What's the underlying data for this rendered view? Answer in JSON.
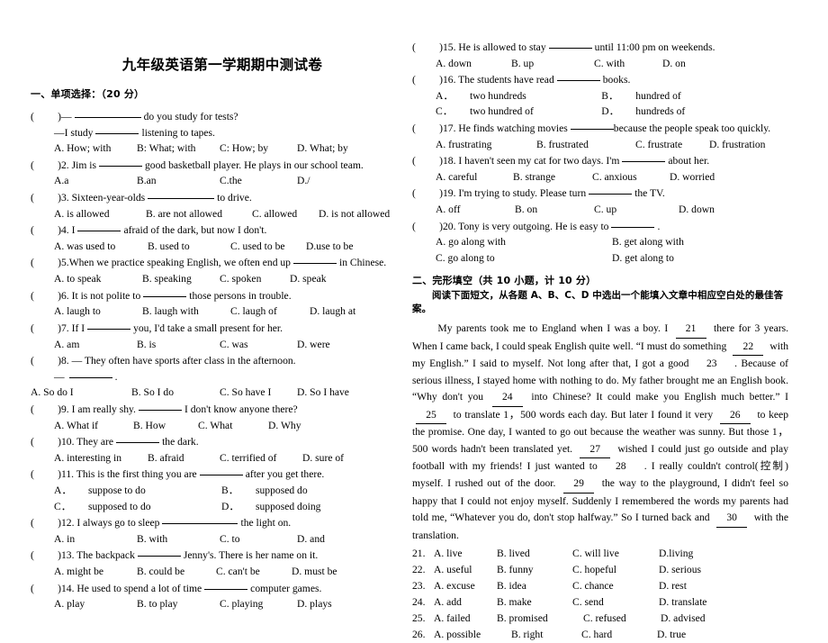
{
  "document": {
    "title": "九年级英语第一学期期中测试卷"
  },
  "sections": {
    "part1": {
      "heading": "一、单项选择：（20 分）"
    },
    "part2": {
      "heading": "二、完形填空（共 10 小题，计 10 分）",
      "instruction": "阅读下面短文，从各题 A、B、C、D 中选出一个能填入文章中相应空白处的最佳答案。"
    }
  },
  "left_column": {
    "questions": [
      {
        "num": "1",
        "stem_a": "—",
        "stem_b": "do you study for tests?",
        "stem2_a": "—I study",
        "stem2_b": "listening to tapes.",
        "options": [
          "A. How; with",
          "B: What; with",
          "C: How; by",
          "D. What; by"
        ]
      },
      {
        "num": "2",
        "stem_a": "2. Jim is",
        "stem_b": "good basketball player. He plays in our school team.",
        "options": [
          "A.a",
          "B.an",
          "C.the",
          "D./"
        ]
      },
      {
        "num": "3",
        "stem_a": "3. Sixteen-year-olds",
        "stem_b": "to drive.",
        "options": [
          "A. is allowed",
          "B. are not allowed",
          "C. allowed",
          "D. is not allowed"
        ]
      },
      {
        "num": "4",
        "stem_a": "4. I",
        "stem_b": "afraid of the dark, but now I don't.",
        "options": [
          "A. was used to",
          "B. used to",
          "C. used to be",
          "D.use to be"
        ]
      },
      {
        "num": "5",
        "stem_a": "5.When we practice speaking English, we often end up",
        "stem_b": "in Chinese.",
        "options": [
          "A. to speak",
          "B. speaking",
          "C. spoken",
          "D. speak"
        ]
      },
      {
        "num": "6",
        "stem_a": "6. It is not polite to",
        "stem_b": "those persons in trouble.",
        "options": [
          "A. laugh to",
          "B. laugh with",
          "C. laugh of",
          "D. laugh at"
        ]
      },
      {
        "num": "7",
        "stem_a": "7. If I",
        "stem_b": "you, I'd take a small present for her.",
        "options": [
          "A. am",
          "B. is",
          "C. was",
          "D. were"
        ]
      },
      {
        "num": "8",
        "stem_a": "8. — They often have sports after class in the afternoon.",
        "stem_b": "",
        "answer_line": "—",
        "options": [
          "A. So do I",
          "B. So I do",
          "C. So have I",
          "D. So I have"
        ]
      },
      {
        "num": "9",
        "stem_a": "9. I am really shy.",
        "stem_b": "I don't know anyone there?",
        "options": [
          "A. What if",
          "B. How",
          "C. What",
          "D. Why"
        ]
      },
      {
        "num": "10",
        "stem_a": "10. They are",
        "stem_b": "the dark.",
        "options": [
          "A. interesting in",
          "B. afraid",
          "C. terrified of",
          "D. sure of"
        ]
      },
      {
        "num": "11",
        "stem_a": "11. This is the first thing you are",
        "stem_b": "after you get there.",
        "options_grid": [
          [
            "A．",
            "suppose to do",
            "B．",
            "supposed do"
          ],
          [
            "C．",
            "supposed to do",
            "D．",
            "supposed doing"
          ]
        ]
      },
      {
        "num": "12",
        "stem_a": "12. I always go to sleep",
        "stem_b": "the light on.",
        "options": [
          "A. in",
          "B. with",
          "C. to",
          "D. and"
        ]
      },
      {
        "num": "13",
        "stem_a": "13. The backpack",
        "stem_b": "Jenny's. There is her name on it.",
        "options": [
          "A. might be",
          "B. could be",
          "C. can't be",
          "D. must be"
        ]
      },
      {
        "num": "14",
        "stem_a": "14. He used to spend a lot of time",
        "stem_b": "computer games.",
        "options": [
          "A. play",
          "B. to play",
          "C. playing",
          "D. plays"
        ]
      }
    ]
  },
  "right_column": {
    "questions": [
      {
        "num": "15",
        "stem_a": "15. He is allowed to stay",
        "stem_b": "until 11:00 pm on weekends.",
        "options": [
          "A. down",
          "B. up",
          "C. with",
          "D. on"
        ]
      },
      {
        "num": "16",
        "stem_a": "16. The students have read",
        "stem_b": "books.",
        "options_grid": [
          [
            "A．",
            "two hundreds",
            "B．",
            "hundred of"
          ],
          [
            "C．",
            "two hundred of",
            "D．",
            "hundreds of"
          ]
        ]
      },
      {
        "num": "17",
        "stem_a": "17. He finds watching movies",
        "stem_b": "because the people speak too quickly.",
        "options": [
          "A. frustrating",
          "B. frustrated",
          "C. frustrate",
          "D. frustration"
        ]
      },
      {
        "num": "18",
        "stem_a": "18. I haven't seen my cat for two days. I'm",
        "stem_b": "about her.",
        "options": [
          "A. careful",
          "B. strange",
          "C. anxious",
          "D. worried"
        ]
      },
      {
        "num": "19",
        "stem_a": "19. I'm trying to study. Please turn",
        "stem_b": "the TV.",
        "options": [
          "A. off",
          "B. on",
          "C. up",
          "D. down"
        ]
      },
      {
        "num": "20",
        "stem_a": "20. Tony is very outgoing. He is easy to",
        "stem_b": ".",
        "options_grid": [
          [
            "",
            "A. go along with",
            "",
            "B. get along with"
          ],
          [
            "",
            "C. go along to",
            "",
            "D. get along to"
          ]
        ]
      }
    ],
    "passage": {
      "segments": [
        {
          "type": "indent"
        },
        {
          "type": "text",
          "value": "My parents took me to England when I was a boy. I"
        },
        {
          "type": "blank",
          "value": "21"
        },
        {
          "type": "text",
          "value": "there for 3 years. When I came back, I could speak English quite well. “I must do something"
        },
        {
          "type": "blank",
          "value": "22"
        },
        {
          "type": "text",
          "value": "with my English.” I said to myself. Not long after that, I got a good"
        },
        {
          "type": "blank_nb",
          "value": "23"
        },
        {
          "type": "text",
          "value": ". Because of serious illness, I stayed home with nothing to do. My father brought me an English book. “Why don't   you"
        },
        {
          "type": "blank",
          "value": "24"
        },
        {
          "type": "text",
          "value": "into Chinese? It could make you English much better.” I"
        },
        {
          "type": "blank",
          "value": "25"
        },
        {
          "type": "text",
          "value": "to translate 1，500 words each day. But later I found it very"
        },
        {
          "type": "blank",
          "value": "26"
        },
        {
          "type": "text",
          "value": "to keep the promise. One day, I wanted to go out because the weather was sunny. But those 1，500 words hadn't been translated yet."
        },
        {
          "type": "blank",
          "value": "27"
        },
        {
          "type": "text",
          "value": "wished I could just go outside and play football with my friends! I just wanted to"
        },
        {
          "type": "blank_nb",
          "value": "28"
        },
        {
          "type": "text",
          "value": ". I really couldn't control(控制) myself. I rushed out of the door."
        },
        {
          "type": "blank",
          "value": "29"
        },
        {
          "type": "text",
          "value": "the way to the playground, I didn't feel so happy that I could not enjoy myself. Suddenly I remembered the words my parents had told me, “Whatever you do, don't stop halfway.” So I turned back and"
        },
        {
          "type": "blank",
          "value": "30"
        },
        {
          "type": "text",
          "value": "with the translation."
        }
      ]
    },
    "cloze_options": [
      {
        "num": "21.",
        "options": [
          "A. live",
          "B. lived",
          "C. will live",
          "D.living"
        ]
      },
      {
        "num": "22.",
        "options": [
          "A. useful",
          "B. funny",
          "C. hopeful",
          "D. serious"
        ]
      },
      {
        "num": "23.",
        "options": [
          "A. excuse",
          "B. idea",
          "C. chance",
          "D. rest"
        ]
      },
      {
        "num": "24.",
        "options": [
          "A. add",
          "B. make",
          "C. send",
          "D. translate"
        ]
      },
      {
        "num": "25.",
        "options": [
          "A. failed",
          "B. promised",
          "C. refused",
          "D. advised"
        ]
      },
      {
        "num": "26.",
        "options": [
          "A. possible",
          "B. right",
          "C. hard",
          "D. true"
        ]
      }
    ]
  }
}
